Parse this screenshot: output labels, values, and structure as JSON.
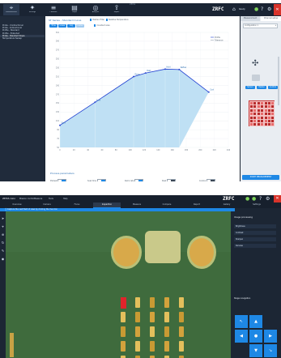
{
  "top": {
    "window_title": "ZEISS",
    "toolbar": [
      {
        "label": "Measurement",
        "icon": "measure-icon"
      },
      {
        "label": "Settings",
        "icon": "settings-icon"
      },
      {
        "label": "Calibrate",
        "icon": "calibrate-icon"
      },
      {
        "label": "Graph",
        "icon": "graph-icon"
      },
      {
        "label": "Analysis",
        "icon": "analysis-icon"
      },
      {
        "label": "Export",
        "icon": "export-icon"
      }
    ],
    "logo": "ZRFC",
    "status": "Ready",
    "sidebar_items": [
      "Probe - Unidirectional",
      "Probe - bidirectional",
      "Profile - Standard",
      "Profile - Extended",
      "Probe - Standard Slope",
      "Temperature Sweep"
    ],
    "selected_sidebar_item": 4,
    "chart_title": "ST Series - Standard Curve",
    "chart_options": [
      "Median Filter",
      "Relative Temperature"
    ],
    "view_tabs": [
      "Time",
      "Linear",
      "Log",
      "Cumul"
    ],
    "legend_checkbox": "Constant area",
    "chart_data": {
      "type": "line",
      "x": [
        0,
        50,
        105,
        122,
        150,
        170,
        212
      ],
      "y": [
        100,
        152,
        210,
        218,
        227,
        226,
        175
      ],
      "xlim": [
        0,
        240
      ],
      "ylim": [
        50,
        310
      ],
      "grid": true,
      "point_labels": [
        "Start",
        "Soak",
        "Ramp",
        "Peak",
        "Hold",
        "Reflow",
        "Cool"
      ],
      "legend": [
        "Profile",
        "Tolerance"
      ],
      "legend_position": "top-right",
      "line_color": "#1f3fd1",
      "area_color": "#bfe0f4"
    },
    "profile_parameters": {
      "title": "Process parameters",
      "controls": [
        {
          "label": "Preheat",
          "state": "on"
        },
        {
          "label": "Soak time",
          "state": "on"
        },
        {
          "label": "Ramp rate",
          "state": "on"
        },
        {
          "label": "Peak",
          "state": "off"
        },
        {
          "label": "Cooling",
          "state": "off"
        }
      ]
    },
    "right_panel": {
      "tabs": [
        "Measurement",
        "Channel setup"
      ],
      "dropdown": "Configuration 1",
      "section_buttons": [
        "Sensor",
        "Heater",
        "Control"
      ],
      "action_button": "START MEASUREMENT",
      "heatmap_accent": "#d73b3b"
    }
  },
  "bottom": {
    "window_title": "ZEISS Axio",
    "menu": [
      "Mission control",
      "Measure",
      "Tools",
      "Help"
    ],
    "logo": "ZRFC",
    "nav_tabs": [
      "Overview",
      "Camera",
      "Focus",
      "Inspection",
      "Measure",
      "Compare",
      "Report",
      "Gallery",
      "Settings"
    ],
    "active_tab": 3,
    "info_bar": "Capture the next field of view by clicking the live icon",
    "right_panel_title": "Image processing",
    "right_panel_items": [
      "Brightness",
      "Contrast",
      "Sharpen",
      "Denoise"
    ],
    "dpad_title": "Stage navigation",
    "tools": [
      "pointer-icon",
      "measure-icon",
      "zoom-icon",
      "rotate-icon",
      "annotate-icon",
      "camera-icon"
    ],
    "accent": "#1e88e5",
    "board_color": "#3f6b3d"
  }
}
